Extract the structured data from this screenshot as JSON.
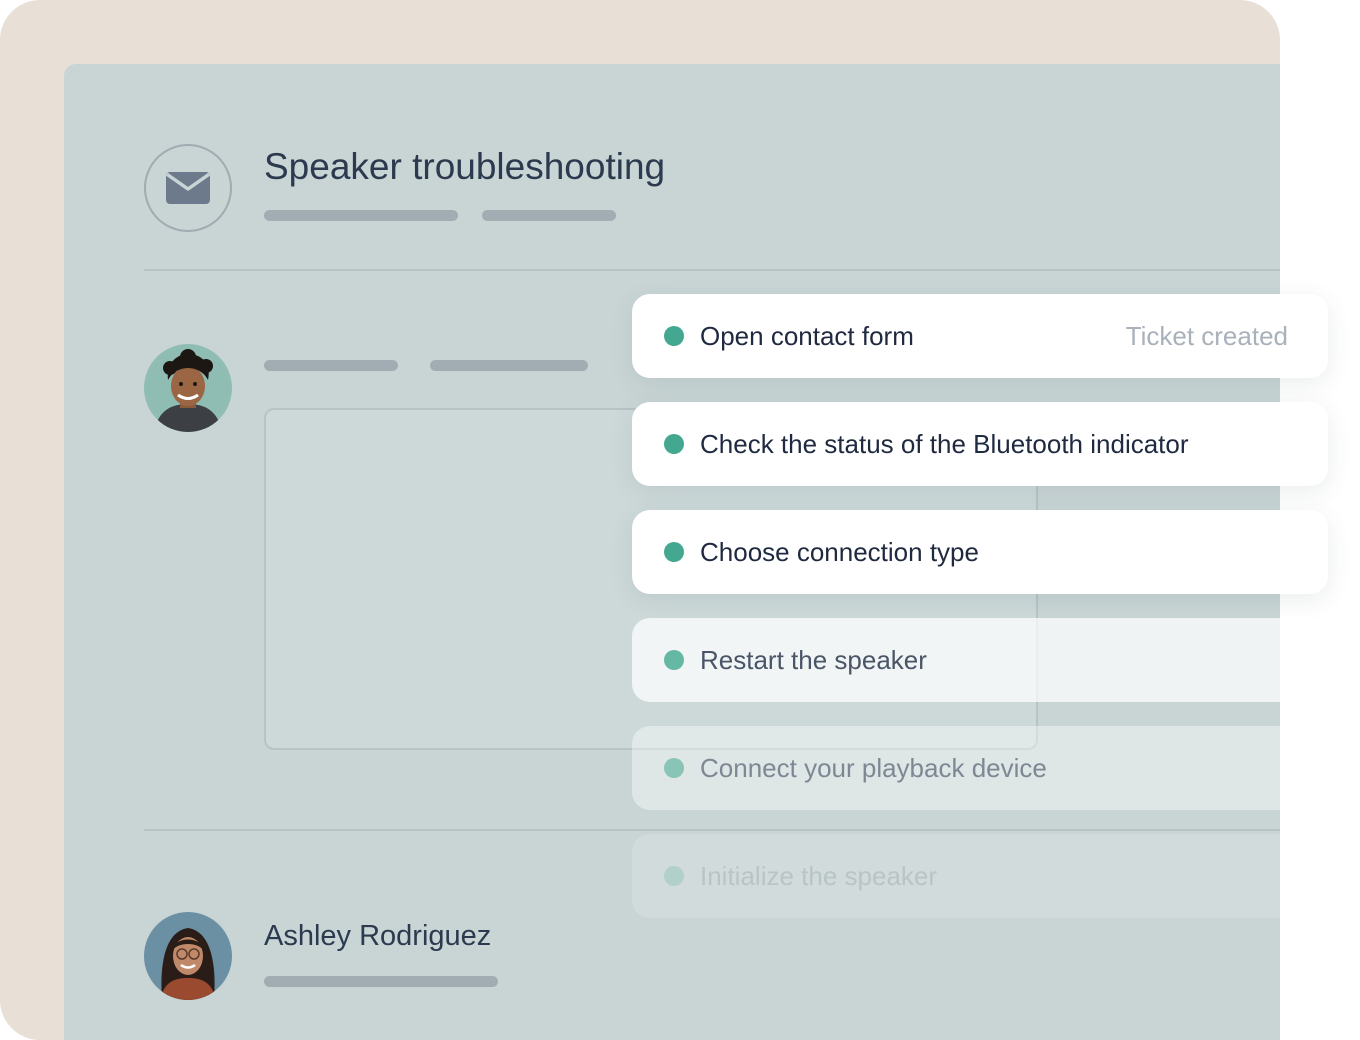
{
  "ticket": {
    "title": "Speaker troubleshooting",
    "icon": "envelope-icon"
  },
  "agent": {
    "avatar": "agent-avatar"
  },
  "customer": {
    "name": "Ashley Rodriguez",
    "avatar": "customer-avatar"
  },
  "steps": [
    {
      "label": "Open contact form",
      "status": "Ticket created"
    },
    {
      "label": "Check the status of the Bluetooth indicator"
    },
    {
      "label": "Choose connection type"
    },
    {
      "label": "Restart the speaker"
    },
    {
      "label": "Connect your playback device"
    },
    {
      "label": "Initialize the speaker"
    }
  ],
  "colors": {
    "backdrop": "#e8dfd6",
    "panel": "#c9d5d5",
    "accent_dot": "#43a88f",
    "title_text": "#2c3a4f"
  }
}
